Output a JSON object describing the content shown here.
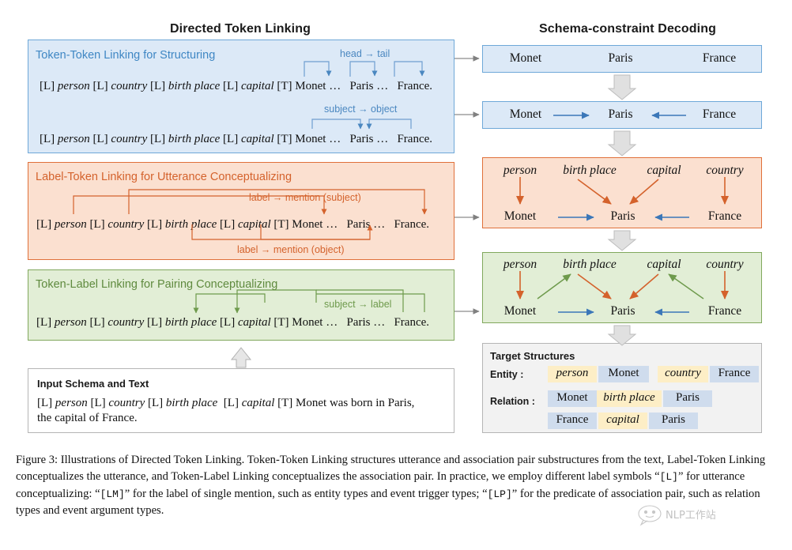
{
  "figure": {
    "left_column_title": "Directed Token Linking",
    "right_column_title": "Schema-constraint Decoding"
  },
  "left_panels": [
    {
      "id": "token-token",
      "heading": "Token-Token Linking for Structuring",
      "color": "#3f87c4",
      "annotations": [
        "head → tail",
        "subject → object"
      ],
      "token_line": {
        "schema": [
          {
            "t": "[L]",
            "italic": false
          },
          {
            "t": "person",
            "italic": true
          },
          {
            "t": "[L]",
            "italic": false
          },
          {
            "t": "country",
            "italic": true
          },
          {
            "t": "[L]",
            "italic": false
          },
          {
            "t": "birth place",
            "italic": true
          },
          {
            "t": "[L]",
            "italic": false
          },
          {
            "t": "capital",
            "italic": true
          },
          {
            "t": "[T]",
            "italic": false
          }
        ],
        "text": "Monet …   Paris …   France."
      }
    },
    {
      "id": "label-token",
      "heading": "Label-Token Linking for Utterance Conceptualizing",
      "color": "#d4622c",
      "annotations": [
        "label → mention (subject)",
        "label → mention (object)"
      ]
    },
    {
      "id": "token-label",
      "heading": "Token-Label Linking for  Pairing Conceptualizing",
      "color": "#5f8a3e",
      "annotations": [
        "subject → label"
      ]
    }
  ],
  "input_box": {
    "title": "Input Schema and Text",
    "line1_schema": [
      {
        "t": "[L]",
        "italic": false
      },
      {
        "t": "person",
        "italic": true
      },
      {
        "t": "[L]",
        "italic": false
      },
      {
        "t": "country",
        "italic": true
      },
      {
        "t": "[L]",
        "italic": false
      },
      {
        "t": "birth place",
        "italic": true
      },
      {
        "t": "[L]",
        "italic": false
      },
      {
        "t": "capital",
        "italic": true
      },
      {
        "t": "[T]",
        "italic": false
      }
    ],
    "line1_text": "Monet was born in Paris,",
    "line2_text": "the capital of  France."
  },
  "right_steps": [
    {
      "id": "step1",
      "style": "blue",
      "nodes": [
        "Monet",
        "Paris",
        "France"
      ],
      "edges": []
    },
    {
      "id": "step2",
      "style": "blue",
      "nodes": [
        "Monet",
        "Paris",
        "France"
      ],
      "edges": [
        {
          "from": "Monet",
          "to": "Paris",
          "direction": "right",
          "color": "#3b77b8"
        },
        {
          "from": "France",
          "to": "Paris",
          "direction": "left",
          "color": "#3b77b8"
        }
      ]
    },
    {
      "id": "step3",
      "style": "orange",
      "labels": [
        "person",
        "birth place",
        "capital",
        "country"
      ],
      "nodes": [
        "Monet",
        "Paris",
        "France"
      ],
      "label_edges": [
        {
          "label": "person",
          "target": "Monet",
          "color": "#d4622c"
        },
        {
          "label": "birth place",
          "target": "Paris",
          "color": "#d4622c"
        },
        {
          "label": "capital",
          "target": "Paris",
          "color": "#d4622c"
        },
        {
          "label": "country",
          "target": "France",
          "color": "#d4622c"
        }
      ],
      "edges": [
        {
          "from": "Monet",
          "to": "Paris",
          "direction": "right",
          "color": "#3b77b8"
        },
        {
          "from": "France",
          "to": "Paris",
          "direction": "left",
          "color": "#3b77b8"
        }
      ]
    },
    {
      "id": "step4",
      "style": "green",
      "labels": [
        "person",
        "birth place",
        "capital",
        "country"
      ],
      "nodes": [
        "Monet",
        "Paris",
        "France"
      ],
      "label_edges": [
        {
          "label": "person",
          "target": "Monet",
          "color": "#d4622c"
        },
        {
          "label": "birth place",
          "target": "Paris",
          "color": "#d4622c"
        },
        {
          "label": "capital",
          "target": "Paris",
          "color": "#d4622c"
        },
        {
          "label": "country",
          "target": "France",
          "color": "#d4622c"
        }
      ],
      "pair_edges": [
        {
          "from": "Monet",
          "to": "birth place",
          "color": "#6e9a4c"
        },
        {
          "from": "France",
          "to": "capital",
          "color": "#6e9a4c"
        }
      ],
      "edges": [
        {
          "from": "Monet",
          "to": "Paris",
          "direction": "right",
          "color": "#3b77b8"
        },
        {
          "from": "France",
          "to": "Paris",
          "direction": "left",
          "color": "#3b77b8"
        }
      ]
    }
  ],
  "target_structures": {
    "title": "Target Structures",
    "entity_label": "Entity :",
    "relation_label": "Relation :",
    "entity_rows": [
      [
        {
          "text": "person",
          "kind": "label"
        },
        {
          "text": "Monet",
          "kind": "entity"
        },
        {
          "text": "country",
          "kind": "label"
        },
        {
          "text": "France",
          "kind": "entity"
        }
      ]
    ],
    "relation_rows": [
      [
        {
          "text": "Monet",
          "kind": "entity"
        },
        {
          "text": "birth place",
          "kind": "label"
        },
        {
          "text": "Paris",
          "kind": "entity"
        }
      ],
      [
        {
          "text": "France",
          "kind": "entity"
        },
        {
          "text": "capital",
          "kind": "label"
        },
        {
          "text": "Paris",
          "kind": "entity"
        }
      ]
    ],
    "colors": {
      "label_bg": "#fdeec6",
      "entity_bg": "#cfdced"
    }
  },
  "caption": {
    "text": "Figure 3: Illustrations of Directed Token Linking. Token-Token Linking structures utterance and association pair substructures from the text, Label-Token Linking conceptualizes the utterance, and Token-Label Linking conceptualizes the association pair. In practice, we employ different label symbols “[L]” for utterance conceptualizing: “[LM]” for the label of single mention, such as entity types and event trigger types; “[LP]” for the predicate of association pair, such as relation types and event argument types.",
    "parts": [
      {
        "t": "Figure 3: Illustrations of Directed Token Linking. Token-Token Linking structures utterance and association pair substructures from the text, Label-Token Linking conceptualizes the utterance, and Token-Label Linking conceptualizes the association pair. In practice, we employ different label symbols “",
        "mono": false
      },
      {
        "t": "[L]",
        "mono": true
      },
      {
        "t": "” for utterance conceptualizing: “",
        "mono": false
      },
      {
        "t": "[LM]",
        "mono": true
      },
      {
        "t": "” for the label of single mention, such as entity types and event trigger types; “",
        "mono": false
      },
      {
        "t": "[LP]",
        "mono": true
      },
      {
        "t": "” for the predicate of association pair, such as relation types and event argument types.",
        "mono": false
      }
    ]
  },
  "colors": {
    "blue_fill": "#dce9f7",
    "blue_stroke": "#6ea8d8",
    "blue_text": "#3f87c4",
    "orange_fill": "#fbe0d0",
    "orange_stroke": "#e0703a",
    "orange_text": "#d4622c",
    "green_fill": "#e2eed6",
    "green_stroke": "#81a85d",
    "green_text": "#5f8a3e",
    "grey_fill": "#f2f2f2",
    "grey_stroke": "#b5b5b5",
    "arrow_grey": "#d4d4d4",
    "arrow_blue": "#3b77b8"
  }
}
